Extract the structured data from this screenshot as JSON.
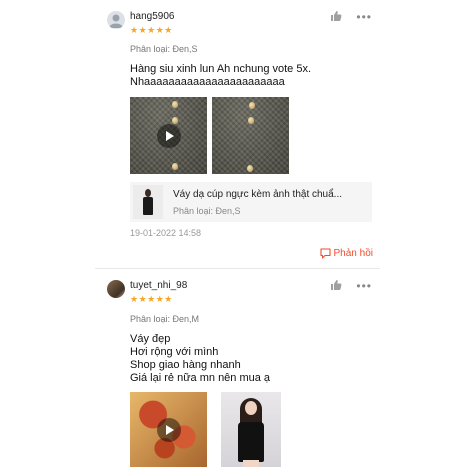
{
  "reviews": [
    {
      "username": "hang5906",
      "stars": "★★★★★",
      "variant": "Phân loại: Đen,S",
      "content": "Hàng siu xinh lun Ah nchung vote 5x.\nNhaaaaaaaaaaaaaaaaaaaaaaa",
      "product": {
        "name": "Váy dạ cúp ngực kèm ảnh thật chuẩ...",
        "variant": "Phân loại:  Đen,S"
      },
      "timestamp": "19-01-2022 14:58",
      "reply_label": "Phản hồi"
    },
    {
      "username": "tuyet_nhi_98",
      "stars": "★★★★★",
      "variant": "Phân loại: Đen,M",
      "content": "Váy đẹp\nHơi rộng với mình\nShop giao hàng nhanh\nGiá lại rẻ nữa mn nên mua ạ"
    }
  ],
  "icons": {
    "like": "thumbs-up-icon",
    "more": "more-options-icon",
    "play": "play-icon",
    "reply": "chat-bubble-icon",
    "star": "star-icon"
  },
  "colors": {
    "accent": "#ee4d2d",
    "star": "#f5a623",
    "muted_text": "#777777"
  },
  "more_glyph": "•••"
}
